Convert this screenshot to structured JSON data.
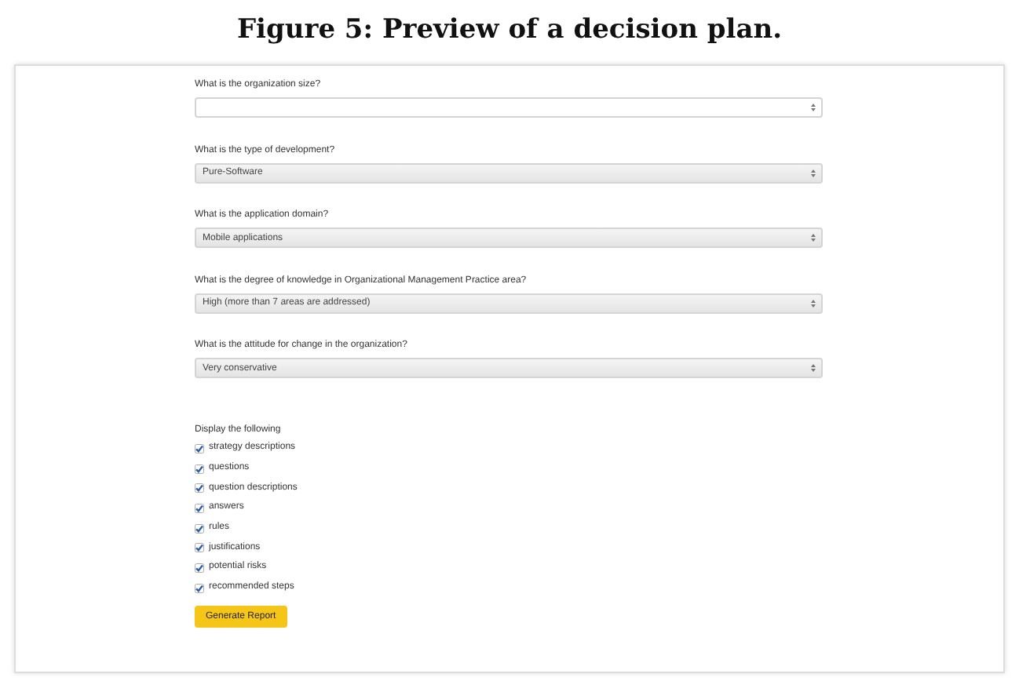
{
  "caption": "Figure 5: Preview of a decision plan.",
  "questions": [
    {
      "label": "What is the organization size?",
      "kind": "number"
    },
    {
      "label": "What is the type of development?",
      "kind": "select",
      "value": "Pure-Software"
    },
    {
      "label": "What is the application domain?",
      "kind": "select",
      "value": "Mobile applications"
    },
    {
      "label": "What is the degree of knowledge in Organizational Management Practice area?",
      "kind": "select",
      "value": "High (more than 7 areas are addressed)"
    },
    {
      "label": "What is the attitude for change in the organization?",
      "kind": "select",
      "value": "Very conservative"
    }
  ],
  "display": {
    "heading": "Display the following",
    "options": [
      {
        "label": "strategy descriptions",
        "checked": true
      },
      {
        "label": "questions",
        "checked": true
      },
      {
        "label": "question descriptions",
        "checked": true
      },
      {
        "label": "answers",
        "checked": true
      },
      {
        "label": "rules",
        "checked": true
      },
      {
        "label": "justifications",
        "checked": true
      },
      {
        "label": "potential risks",
        "checked": true
      },
      {
        "label": "recommended steps",
        "checked": true
      }
    ]
  },
  "button": "Generate Report"
}
